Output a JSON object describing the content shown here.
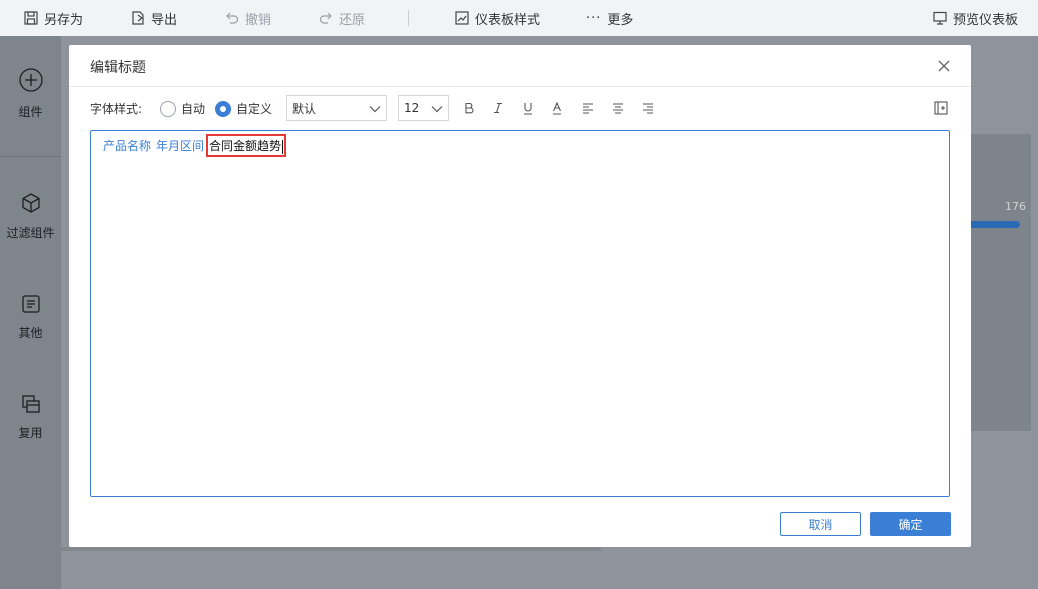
{
  "toolbar": {
    "save_as": "另存为",
    "export": "导出",
    "undo": "撤销",
    "redo": "还原",
    "dashboard_style": "仪表板样式",
    "more": "更多",
    "preview": "预览仪表板"
  },
  "sidebar": {
    "items": [
      {
        "label": "组件",
        "icon": "plus-circle-icon"
      },
      {
        "label": "过滤组件",
        "icon": "cube-icon"
      },
      {
        "label": "其他",
        "icon": "document-icon"
      },
      {
        "label": "复用",
        "icon": "layers-icon"
      }
    ]
  },
  "background": {
    "peek_value": "176"
  },
  "dialog": {
    "title": "编辑标题",
    "font_style_label": "字体样式:",
    "radio_auto": "自动",
    "radio_custom": "自定义",
    "selected_mode": "custom",
    "font_family": "默认",
    "font_size": "12",
    "format_buttons": [
      "bold",
      "italic",
      "underline",
      "font-color",
      "align-left",
      "align-center",
      "align-right"
    ],
    "editor": {
      "tags": [
        "产品名称",
        "年月区间"
      ],
      "typed_text": "合同金额趋势"
    },
    "cancel_label": "取消",
    "ok_label": "确定"
  },
  "colors": {
    "accent": "#3a7fd5",
    "highlight_box": "#e53935",
    "overlay_background": "#8e939c"
  }
}
